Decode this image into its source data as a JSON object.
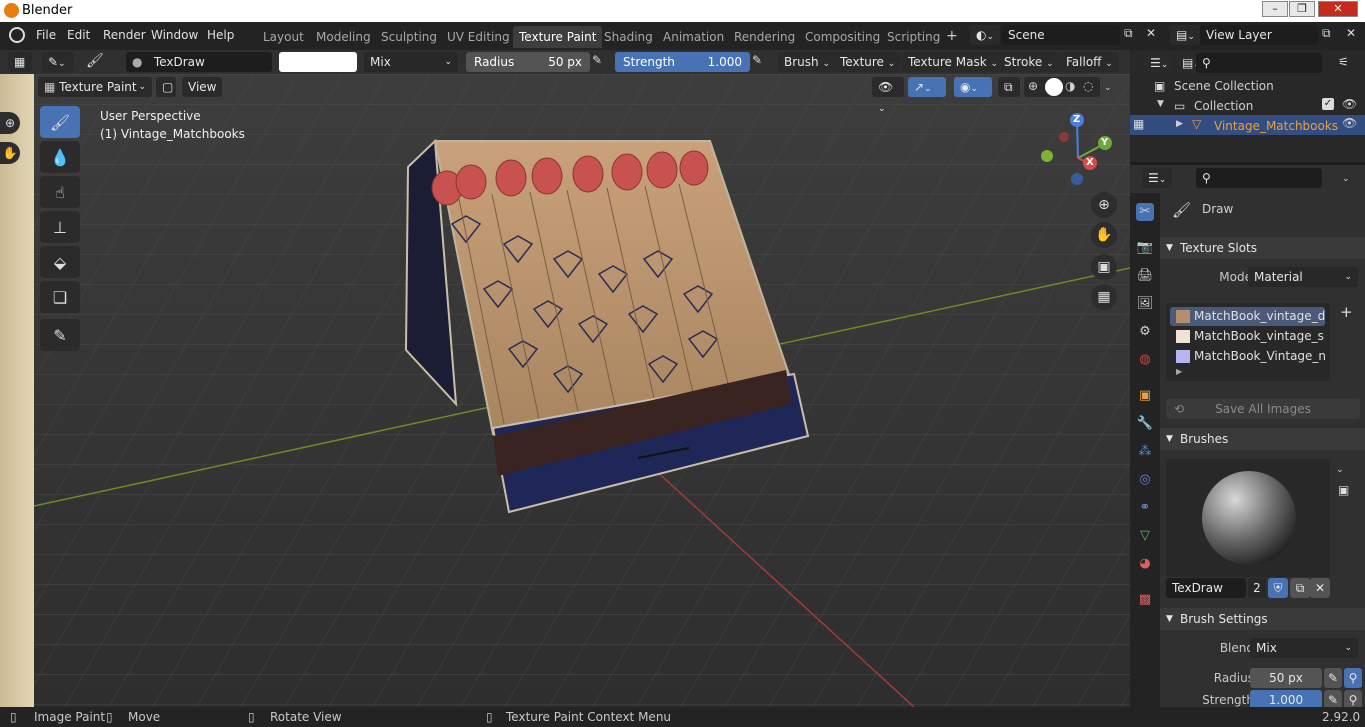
{
  "window": {
    "title": "Blender"
  },
  "menu": [
    "File",
    "Edit",
    "Render",
    "Window",
    "Help"
  ],
  "workspaces": [
    "Layout",
    "Modeling",
    "Sculpting",
    "UV Editing",
    "Texture Paint",
    "Shading",
    "Animation",
    "Rendering",
    "Compositing",
    "Scripting"
  ],
  "active_workspace": "Texture Paint",
  "scene": {
    "label": "Scene",
    "view_layer": "View Layer",
    "add": "+"
  },
  "tool_header": {
    "brush_name": "TexDraw",
    "blend": "Mix",
    "radius_label": "Radius",
    "radius_value": "50 px",
    "strength_label": "Strength",
    "strength_value": "1.000",
    "menus": [
      "Brush",
      "Texture",
      "Texture Mask",
      "Stroke",
      "Falloff"
    ]
  },
  "viewport_header": {
    "mode": "Texture Paint",
    "view": "View"
  },
  "viewport": {
    "perspective": "User Perspective",
    "object": "(1) Vintage_Matchbooks",
    "gizmo": {
      "x": "X",
      "y": "Y",
      "z": "Z"
    }
  },
  "outliner": {
    "scene_collection": "Scene Collection",
    "collection": "Collection",
    "object": "Vintage_Matchbooks"
  },
  "properties": {
    "tool_name": "Draw",
    "texture_slots": {
      "header": "Texture Slots",
      "mode_label": "Mode",
      "mode_value": "Material",
      "slots": [
        "MatchBook_vintage_diff...",
        "MatchBook_vintage_sp...",
        "MatchBook_Vintage_no..."
      ],
      "save_all": "Save All Images"
    },
    "brushes": {
      "header": "Brushes",
      "name": "TexDraw",
      "users": "2"
    },
    "brush_settings": {
      "header": "Brush Settings",
      "blend_label": "Blend",
      "blend_value": "Mix",
      "radius_label": "Radius",
      "radius_value": "50 px",
      "strength_label": "Strength",
      "strength_value": "1.000"
    }
  },
  "statusbar": {
    "items": [
      "Image Paint",
      "Move",
      "Rotate View",
      "Texture Paint Context Menu"
    ],
    "version": "2.92.0"
  },
  "colors": {
    "accent": "#4772b3",
    "active_object": "#e8a040",
    "header": "#303030"
  }
}
